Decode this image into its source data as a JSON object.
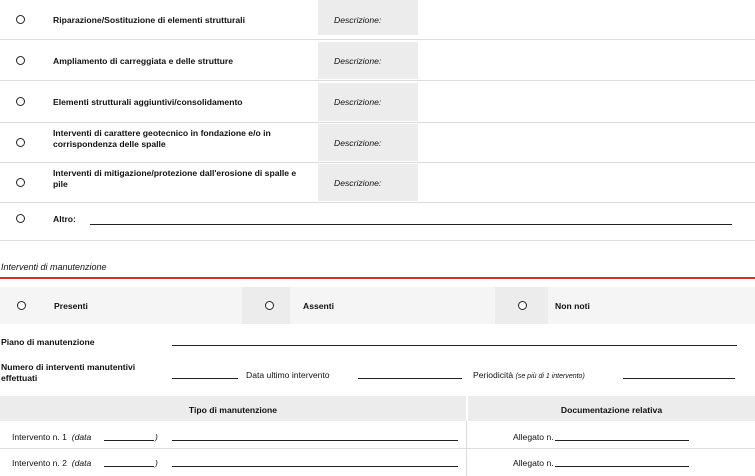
{
  "interventions": {
    "rows": [
      {
        "label": "Riparazione/Sostituzione di elementi strutturali",
        "desc_label": "Descrizione:"
      },
      {
        "label": "Ampliamento di carreggiata e delle strutture",
        "desc_label": "Descrizione:"
      },
      {
        "label": "Elementi strutturali aggiuntivi/consolidamento",
        "desc_label": "Descrizione:"
      },
      {
        "label": "Interventi di carattere geotecnico in fondazione e/o in corrispondenza delle spalle",
        "desc_label": "Descrizione:"
      },
      {
        "label": "Interventi di mitigazione/protezione dall'erosione di spalle e pile",
        "desc_label": "Descrizione:"
      }
    ],
    "other_label": "Altro:"
  },
  "maintenance": {
    "section_title": "Interventi di manutenzione",
    "options": [
      "Presenti",
      "Assenti",
      "Non noti"
    ],
    "plan_label": "Piano di manutenzione",
    "count_label": "Numero di interventi manutentivi effettuati",
    "last_date_label": "Data ultimo intervento",
    "periodicity_label": "Periodicità",
    "periodicity_note": "(se più di 1 intervento)",
    "table": {
      "col_type": "Tipo di manutenzione",
      "col_docs": "Documentazione relativa",
      "rows": [
        {
          "label": "Intervento n. 1",
          "date_label": "(data",
          "date_close": ")",
          "attachment": "Allegato n."
        },
        {
          "label": "Intervento n. 2",
          "date_label": "(data",
          "date_close": ")",
          "attachment": "Allegato n."
        }
      ]
    }
  },
  "colors": {
    "accent_red": "#d2322d",
    "shade_gray": "#ececec"
  }
}
